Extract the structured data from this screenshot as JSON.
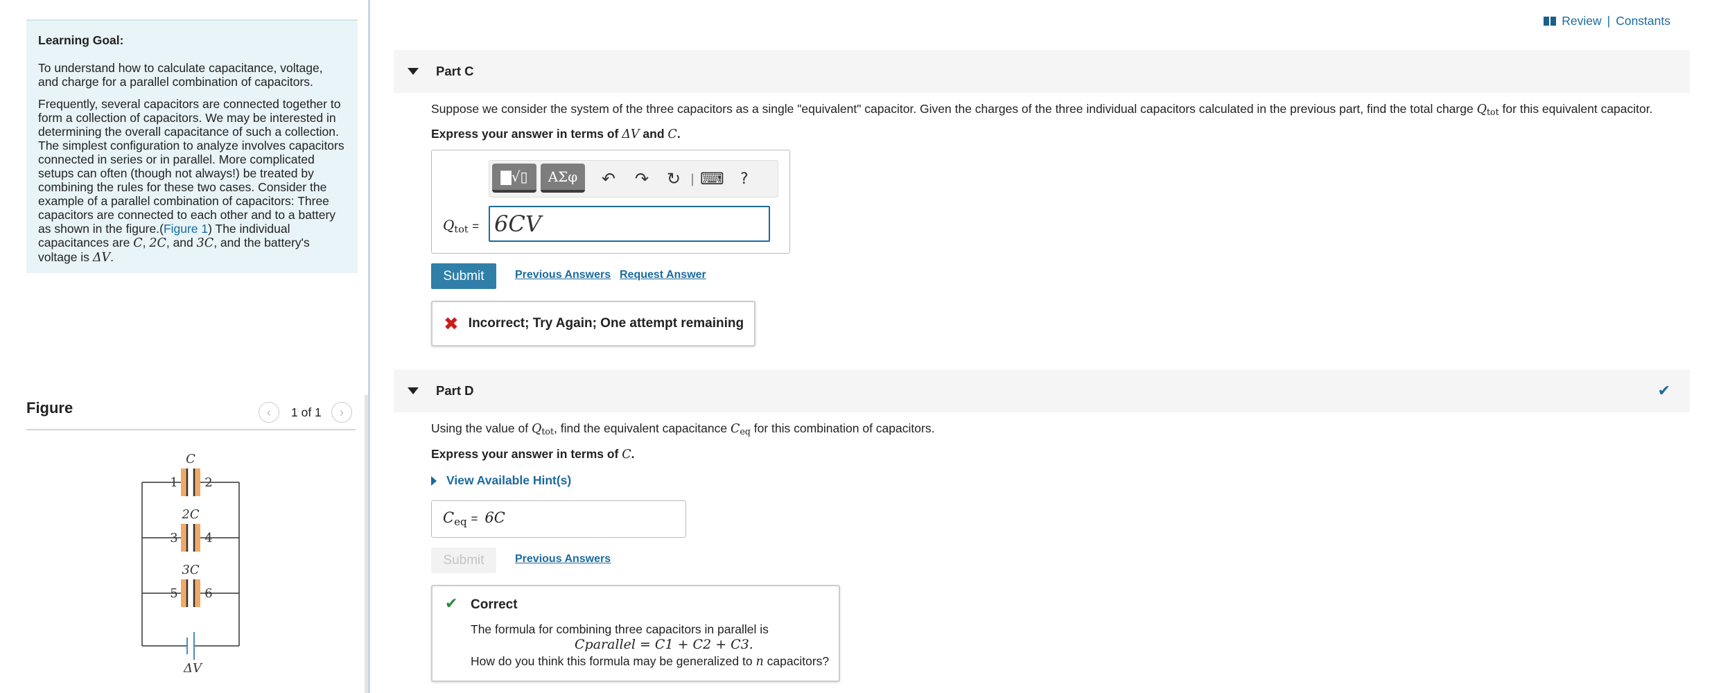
{
  "header": {
    "review": "Review",
    "separator": "|",
    "constants": "Constants"
  },
  "goal": {
    "title": "Learning Goal:",
    "p1": "To understand how to calculate capacitance, voltage, and charge for a parallel combination of capacitors.",
    "p2_before": "Frequently, several capacitors are connected together to form a collection of capacitors. We may be interested in determining the overall capacitance of such a collection. The simplest configuration to analyze involves capacitors connected in series or in parallel. More complicated setups can often (though not always!) be treated by combining the rules for these two cases. Consider the example of a parallel combination of capacitors: Three capacitors are connected to each other and to a battery as shown in the figure.(",
    "p2_link": "Figure 1",
    "p2_after": ") The individual capacitances are",
    "c1": "C",
    "c2": "2C",
    "c3": "3C",
    "and": "and",
    "p2_end": ", and the battery's voltage is",
    "dv": "ΔV"
  },
  "figure": {
    "title": "Figure",
    "page": "1 of 1",
    "prev_icon": "chevron-left-icon",
    "next_icon": "chevron-right-icon",
    "cap_labels": [
      "C",
      "2C",
      "3C"
    ],
    "terminals": [
      "1",
      "2",
      "3",
      "4",
      "5",
      "6"
    ],
    "battery_label": "ΔV",
    "accent": "#f0a966"
  },
  "partC": {
    "label": "Part C",
    "question_pre": "Suppose we consider the system of the three capacitors as a single \"equivalent\" capacitor. Given the charges of the three individual capacitors calculated in the previous part, find the total charge",
    "q_sym": "Q",
    "q_sub": "tot",
    "question_post": "for this equivalent capacitor.",
    "express_pre": "Express your answer in terms of",
    "express_dv": "ΔV",
    "express_and": "and",
    "express_c": "C",
    "express_end": ".",
    "toolbar": {
      "templates": "▇√▯",
      "greek": "ΑΣφ",
      "undo": "↶",
      "redo": "↷",
      "reset": "↻",
      "sep": "|",
      "keyboard": "⌨",
      "help": "?"
    },
    "input_label_sym": "Q",
    "input_label_sub": "tot",
    "equals": "=",
    "input_value": "6CV",
    "submit": "Submit",
    "previous_answers": "Previous Answers",
    "request_answer": "Request Answer",
    "feedback": "Incorrect; Try Again; One attempt remaining"
  },
  "partD": {
    "label": "Part D",
    "q_pre": "Using the value of",
    "q_sym": "Q",
    "q_sub": "tot",
    "q_mid": ", find the equivalent capacitance",
    "ceq_sym": "C",
    "ceq_sub": "eq",
    "q_post": "for this combination of capacitors.",
    "express_pre": "Express your answer in terms of",
    "express_c": "C",
    "express_end": ".",
    "hint": "View Available Hint(s)",
    "answer_label_sym": "C",
    "answer_label_sub": "eq",
    "equals": "=",
    "answer_value": "6C",
    "submit": "Submit",
    "previous_answers": "Previous Answers",
    "feedback_title": "Correct",
    "feedback_l1": "The formula for combining three capacitors in parallel is",
    "formula": "Cparallel = C1 + C2 + C3.",
    "feedback_l3_pre": "How do you think this formula may be generalized to",
    "feedback_n": "n",
    "feedback_l3_post": "capacitors?"
  }
}
